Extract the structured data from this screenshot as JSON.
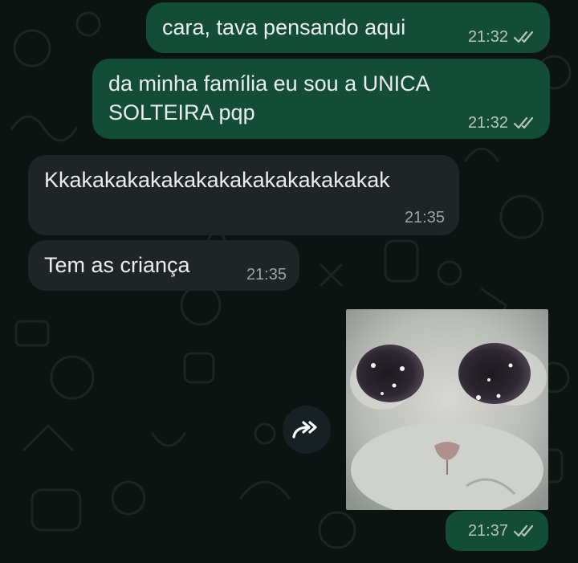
{
  "theme": {
    "outgoing_bubble": "#144d37",
    "incoming_bubble": "#1f2427",
    "background": "#0b1410",
    "tick_color": "#b7c2bd"
  },
  "messages": [
    {
      "direction": "outgoing",
      "text": "cara, tava pensando aqui",
      "time": "21:32",
      "status": "read"
    },
    {
      "direction": "outgoing",
      "text_lines": [
        "da minha família eu sou a UNICA",
        "SOLTEIRA pqp"
      ],
      "time": "21:32",
      "status": "read"
    },
    {
      "direction": "incoming",
      "text": "Kkakakakakakakakakakakakakakak",
      "time": "21:35"
    },
    {
      "direction": "incoming",
      "text": "Tem as criança",
      "time": "21:35"
    },
    {
      "direction": "outgoing",
      "type": "image",
      "image_subject": "crying-cat-meme",
      "time": "21:37",
      "status": "read"
    }
  ],
  "icons": {
    "forward": "forward-icon",
    "read_ticks": "double-check-icon"
  }
}
